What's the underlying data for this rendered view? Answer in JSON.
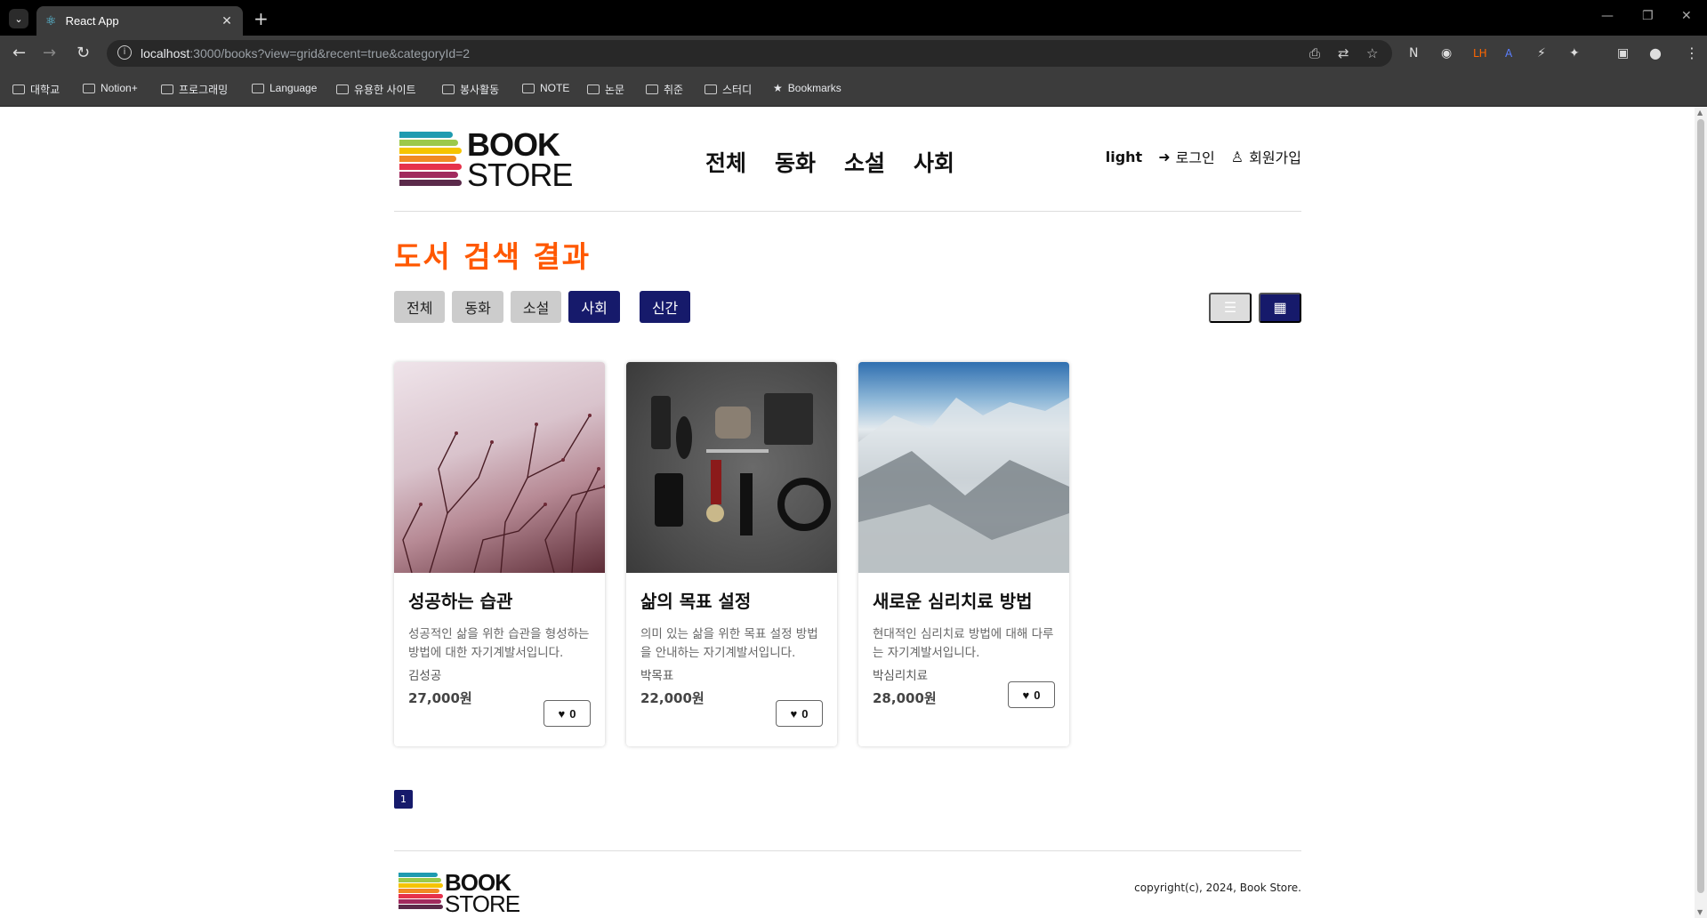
{
  "browser": {
    "tab_title": "React App",
    "url_host": "localhost",
    "url_rest": ":3000/books?view=grid&recent=true&categoryId=2",
    "bookmarks": [
      "대학교",
      "Notion+",
      "프로그래밍",
      "Language",
      "유용한 사이트",
      "봉사활동",
      "NOTE",
      "논문",
      "취준",
      "스터디",
      "Bookmarks"
    ]
  },
  "header": {
    "logo_line1": "BOOK",
    "logo_line2": "STORE",
    "nav": [
      "전체",
      "동화",
      "소설",
      "사회"
    ],
    "theme_label": "light",
    "login_label": "로그인",
    "signup_label": "회원가입"
  },
  "page": {
    "title": "도서 검색 결과",
    "filters": [
      {
        "label": "전체",
        "active": false
      },
      {
        "label": "동화",
        "active": false
      },
      {
        "label": "소설",
        "active": false
      },
      {
        "label": "사회",
        "active": true
      }
    ],
    "new_filter": {
      "label": "신간",
      "active": true
    },
    "view_mode": "grid"
  },
  "books": [
    {
      "title": "성공하는 습관",
      "summary": "성공적인 삶을 위한 습관을 형성하는 방법에 대한 자기계발서입니다.",
      "author": "김성공",
      "price": "27,000원",
      "likes": "0"
    },
    {
      "title": "삶의 목표 설정",
      "summary": "의미 있는 삶을 위한 목표 설정 방법을 안내하는 자기계발서입니다.",
      "author": "박목표",
      "price": "22,000원",
      "likes": "0"
    },
    {
      "title": "새로운 심리치료 방법",
      "summary": "현대적인 심리치료 방법에 대해 다루는 자기계발서입니다.",
      "author": "박심리치료",
      "price": "28,000원",
      "likes": "0"
    }
  ],
  "pagination": {
    "current": "1"
  },
  "footer": {
    "logo_line1": "BOOK",
    "logo_line2": "STORE",
    "copyright": "copyright(c), 2024, Book Store."
  },
  "colors": {
    "accent": "#ff5800",
    "primary": "#161a6b",
    "inactive": "#cccccc"
  }
}
